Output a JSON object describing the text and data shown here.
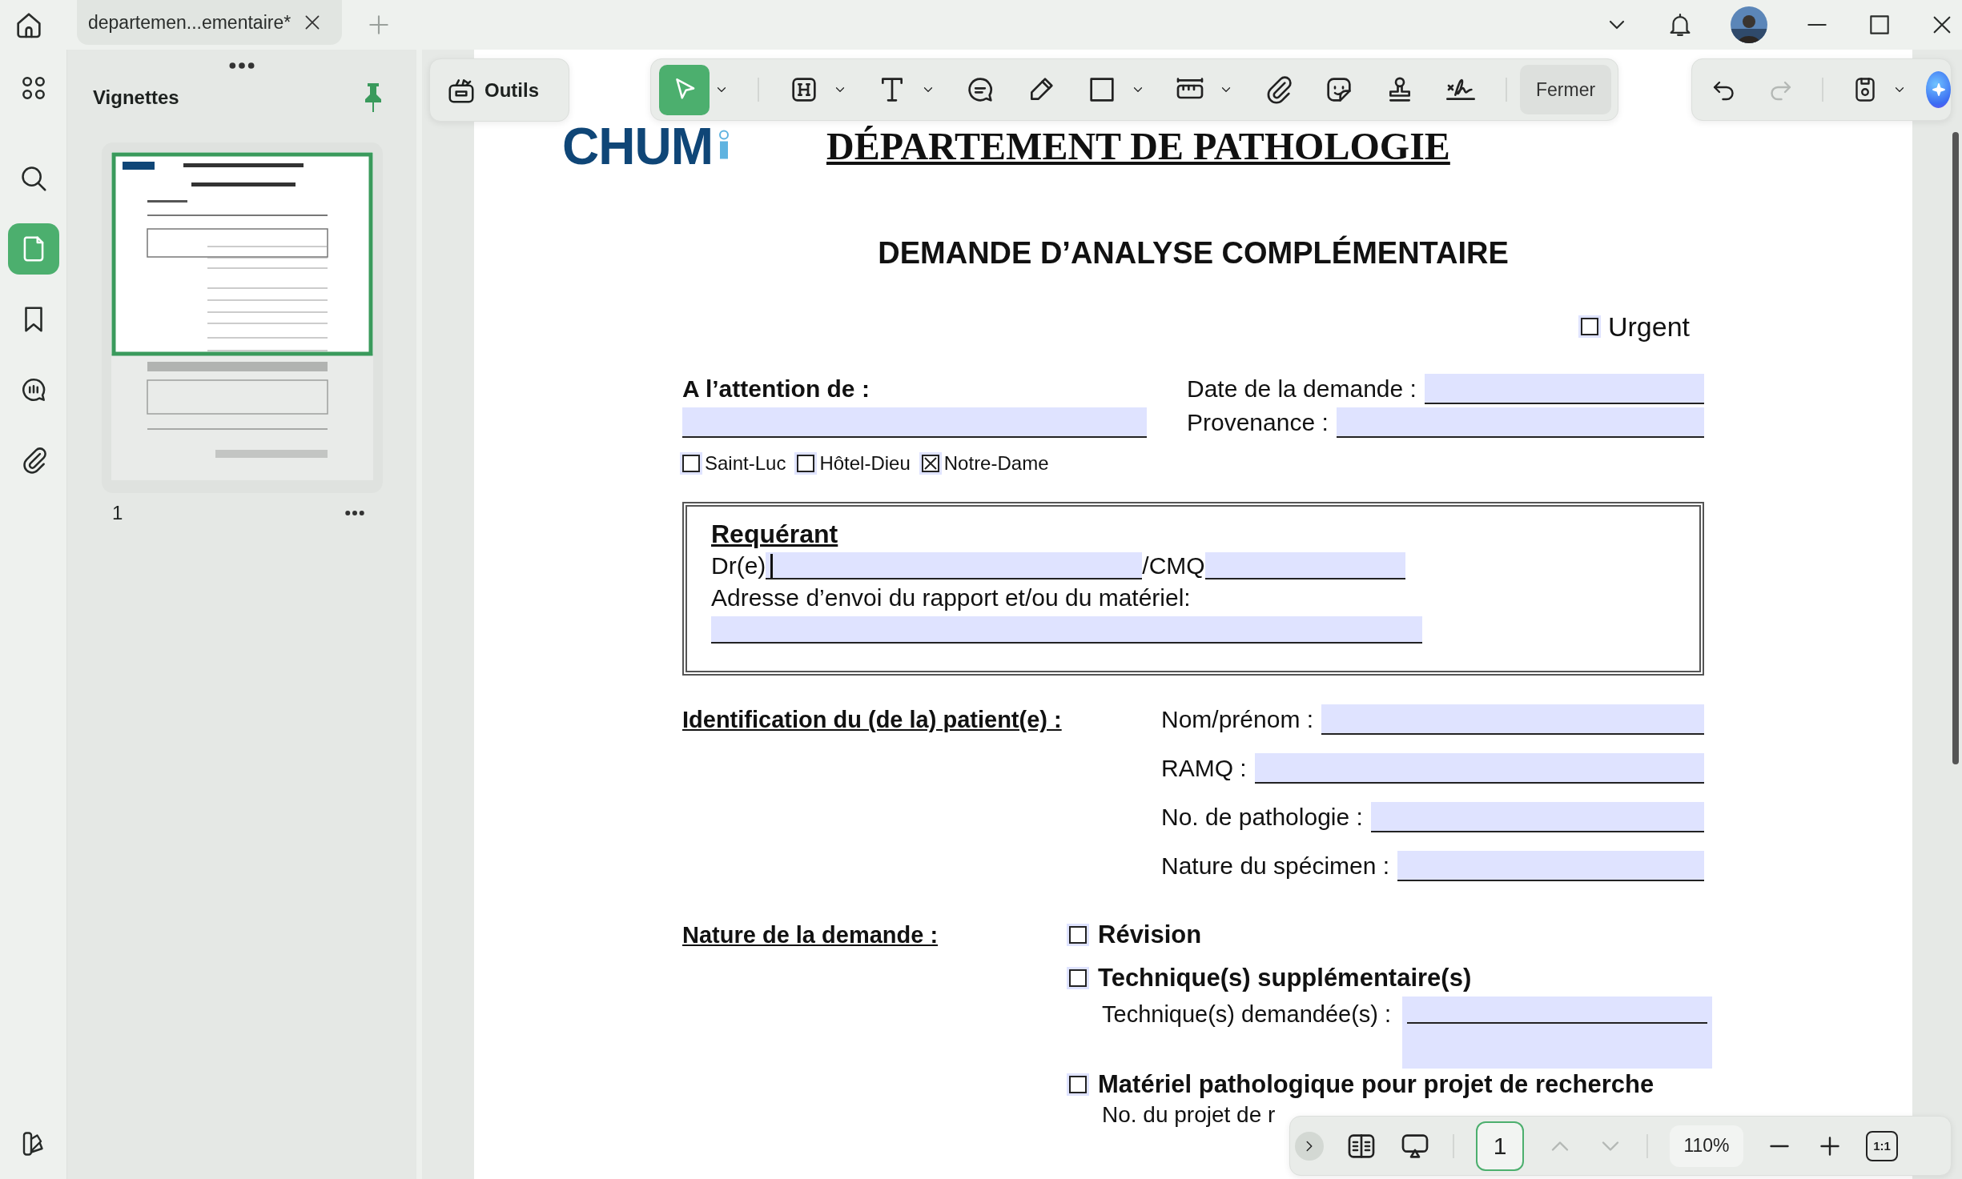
{
  "tabs": [
    {
      "title": "departemen...ementaire*",
      "selected": true
    }
  ],
  "rail": [
    {
      "kind": "thumbnails",
      "selected": false
    },
    {
      "kind": "search",
      "selected": false
    },
    {
      "kind": "pages",
      "selected": true
    },
    {
      "kind": "bookmarks",
      "selected": false
    },
    {
      "kind": "comments",
      "selected": false
    },
    {
      "kind": "attachments",
      "selected": false
    }
  ],
  "panel": {
    "title": "Vignettes",
    "pinned": true,
    "pages": [
      {
        "number": "1",
        "selected": true
      }
    ]
  },
  "tools_button": "Outils",
  "tools": [
    {
      "kind": "select",
      "selected": true,
      "dropdown": true
    },
    {
      "kind": "heading",
      "selected": false,
      "dropdown": true
    },
    {
      "kind": "text",
      "selected": false,
      "dropdown": true
    },
    {
      "kind": "comment",
      "selected": false,
      "dropdown": false
    },
    {
      "kind": "pen",
      "selected": false,
      "dropdown": false
    },
    {
      "kind": "shape",
      "selected": false,
      "dropdown": true
    },
    {
      "kind": "measure",
      "selected": false,
      "dropdown": true
    },
    {
      "kind": "attach",
      "selected": false,
      "dropdown": false
    },
    {
      "kind": "sticker",
      "selected": false,
      "dropdown": false
    },
    {
      "kind": "stamp",
      "selected": false,
      "dropdown": false
    },
    {
      "kind": "signature",
      "selected": false,
      "dropdown": false
    }
  ],
  "close_button": "Fermer",
  "history": [
    {
      "kind": "undo",
      "disabled": false
    },
    {
      "kind": "redo",
      "disabled": true
    }
  ],
  "document": {
    "logo": "CHUM",
    "department": "DÉPARTEMENT DE PATHOLOGIE",
    "title": "DEMANDE D’ANALYSE COMPLÉMENTAIRE",
    "urgent": {
      "label": "Urgent",
      "checked": false
    },
    "attention_label": "A l’attention de :",
    "date_label": "Date de la demande :",
    "provenance_label": "Provenance :",
    "sites": [
      {
        "label": "Saint-Luc",
        "checked": false
      },
      {
        "label": "Hôtel-Dieu",
        "checked": false
      },
      {
        "label": "Notre-Dame",
        "checked": true
      }
    ],
    "requester": {
      "heading": "Requérant",
      "doctor_label": "Dr(e)",
      "cmq_label": "/CMQ",
      "address_label": "Adresse d’envoi du rapport et/ou du matériel:"
    },
    "patient": {
      "heading": "Identification du (de la) patient(e) :",
      "fields": [
        "Nom/prénom :",
        "RAMQ :",
        "No. de pathologie :",
        "Nature du spécimen :"
      ]
    },
    "request": {
      "heading": "Nature de la demande :",
      "options": [
        {
          "label": "Révision",
          "checked": false
        },
        {
          "label": "Technique(s) supplémentaire(s)",
          "checked": false,
          "sub_label": "Technique(s) demandée(s) :"
        },
        {
          "label": "Matériel pathologique pour projet de recherche",
          "checked": false,
          "sub_label": "No. du projet de r"
        }
      ]
    }
  },
  "page_nav": {
    "page": "1",
    "previous_disabled": true,
    "next_disabled": true,
    "zoom": "110%",
    "actual_size": "1:1"
  }
}
